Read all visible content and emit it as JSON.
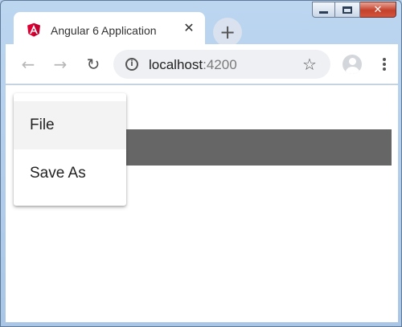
{
  "browser": {
    "tab_title": "Angular 6 Application",
    "tab_close_glyph": "✕",
    "new_tab_glyph": "+",
    "url_host": "localhost",
    "url_port": ":4200",
    "back_glyph": "←",
    "forward_glyph": "→",
    "reload_glyph": "↻",
    "star_glyph": "☆",
    "info_glyph": "i",
    "icons": [
      "angular-logo-icon",
      "back-arrow-icon",
      "forward-arrow-icon",
      "reload-icon",
      "info-icon",
      "star-icon",
      "profile-icon",
      "kebab-menu-icon"
    ]
  },
  "window_controls": {
    "close_glyph": "✕"
  },
  "menu": {
    "items": [
      {
        "label": "File"
      },
      {
        "label": "Save As"
      }
    ]
  },
  "colors": {
    "toolbar_bar": "#666666",
    "angular_red": "#dd0031"
  }
}
